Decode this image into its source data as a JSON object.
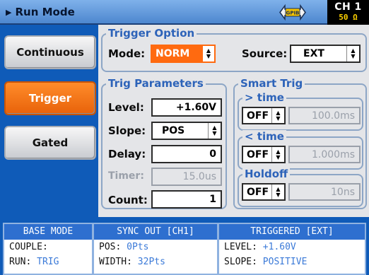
{
  "header": {
    "title": "Run Mode",
    "gpib_label": "GPIB",
    "channel": "CH 1",
    "impedance": "50 Ω"
  },
  "modes": [
    {
      "label": "Continuous",
      "active": false
    },
    {
      "label": "Trigger",
      "active": true
    },
    {
      "label": "Gated",
      "active": false
    }
  ],
  "trigger_option": {
    "title": "Trigger Option",
    "mode_label": "Mode:",
    "mode_value": "NORM",
    "source_label": "Source:",
    "source_value": "EXT"
  },
  "trig_params": {
    "title": "Trig Parameters",
    "level_label": "Level:",
    "level_value": "+1.60V",
    "slope_label": "Slope:",
    "slope_value": "POS",
    "delay_label": "Delay:",
    "delay_value": "0",
    "timer_label": "Timer:",
    "timer_value": "15.0us",
    "count_label": "Count:",
    "count_value": "1"
  },
  "smart_trig": {
    "title": "Smart Trig",
    "gt_title": "> time",
    "gt_state": "OFF",
    "gt_value": "100.0ms",
    "lt_title": "< time",
    "lt_state": "OFF",
    "lt_value": "1.000ms",
    "holdoff_title": "Holdoff",
    "holdoff_state": "OFF",
    "holdoff_value": "10ns"
  },
  "footer": {
    "base_mode": {
      "title": "BASE MODE",
      "couple_label": "COUPLE:",
      "couple_value": "",
      "run_label": "RUN:",
      "run_value": "TRIG"
    },
    "sync_out": {
      "title": "SYNC OUT [CH1]",
      "pos_label": "POS:",
      "pos_value": "0Pts",
      "width_label": "WIDTH:",
      "width_value": "32Pts"
    },
    "triggered": {
      "title": "TRIGGERED [EXT]",
      "level_label": "LEVEL:",
      "level_value": "+1.60V",
      "slope_label": "SLOPE:",
      "slope_value": "POSITIVE"
    }
  },
  "colors": {
    "accent": "#ff6a10",
    "panel_blue": "#0f5bb8",
    "group_title": "#2d63b9",
    "value_blue": "#3b7ad8"
  }
}
